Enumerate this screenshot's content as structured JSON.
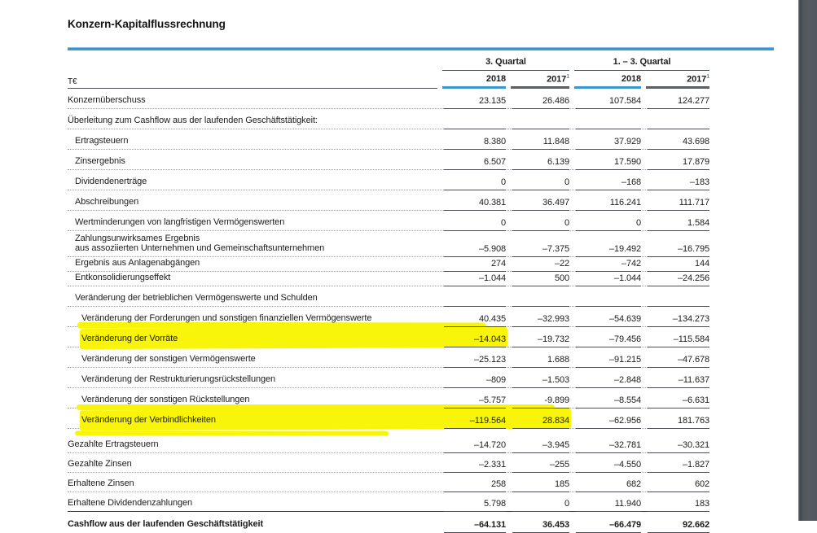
{
  "page": {
    "title": "Konzern-Kapitalflussrechnung",
    "accent_blue": "#3b97d3",
    "highlight_yellow": "#f8f50a",
    "viewer_band_gray": "#53585e"
  },
  "table": {
    "unit_label": "T€",
    "column_groups": [
      {
        "label": "3. Quartal"
      },
      {
        "label": "1. – 3. Quartal"
      }
    ],
    "year_headers": [
      {
        "label": "2018",
        "footnote": "",
        "accent": "blue"
      },
      {
        "label": "2017",
        "footnote": "1",
        "accent": "gray"
      },
      {
        "label": "2018",
        "footnote": "",
        "accent": "blue"
      },
      {
        "label": "2017",
        "footnote": "1",
        "accent": "gray"
      }
    ],
    "rows": [
      {
        "label": "Konzernüberschuss",
        "indent": 0,
        "values": [
          "23.135",
          "26.486",
          "107.584",
          "124.277"
        ]
      },
      {
        "label": "Überleitung zum Cashflow aus der laufenden Geschäftstätigkeit:",
        "indent": 0,
        "values": [
          "",
          "",
          "",
          ""
        ]
      },
      {
        "label": "Ertragsteuern",
        "indent": 1,
        "values": [
          "8.380",
          "11.848",
          "37.929",
          "43.698"
        ]
      },
      {
        "label": "Zinsergebnis",
        "indent": 1,
        "values": [
          "6.507",
          "6.139",
          "17.590",
          "17.879"
        ]
      },
      {
        "label": "Dividendenerträge",
        "indent": 1,
        "values": [
          "0",
          "0",
          "–168",
          "–183"
        ]
      },
      {
        "label": "Abschreibungen",
        "indent": 1,
        "values": [
          "40.381",
          "36.497",
          "116.241",
          "111.717"
        ]
      },
      {
        "label": "Wertminderungen von langfristigen Vermögenswerten",
        "indent": 1,
        "values": [
          "0",
          "0",
          "0",
          "1.584"
        ]
      },
      {
        "label": "Zahlungsunwirksames Ergebnis",
        "label2": "aus assoziierten Unternehmen und Gemeinschaftsunternehmen",
        "indent": 1,
        "values": [
          "–5.908",
          "–7.375",
          "–19.492",
          "–16.795"
        ]
      },
      {
        "label": "Ergebnis aus Anlagenabgängen",
        "indent": 1,
        "size": "c",
        "values": [
          "274",
          "–22",
          "–742",
          "144"
        ]
      },
      {
        "label": "Entkonsolidierungseffekt",
        "indent": 1,
        "size": "c",
        "values": [
          "–1.044",
          "500",
          "–1.044",
          "–24.256"
        ]
      },
      {
        "label": "Veränderung der betrieblichen Vermögenswerte und Schulden",
        "indent": 1,
        "values": [
          "",
          "",
          "",
          ""
        ]
      },
      {
        "label": "Veränderung der Forderungen und sonstigen finanziellen Vermögenswerte",
        "indent": 2,
        "values": [
          "40.435",
          "–32.993",
          "–54.639",
          "–134.273"
        ]
      },
      {
        "label": "Veränderung der Vorräte",
        "indent": 2,
        "highlight": 1,
        "values": [
          "–14.043",
          "–19.732",
          "–79.456",
          "–115.584"
        ]
      },
      {
        "label": "Veränderung der sonstigen Vermögenswerte",
        "indent": 2,
        "values": [
          "–25.123",
          "1.688",
          "–91.215",
          "–47.678"
        ]
      },
      {
        "label": "Veränderung der Restrukturierungsrückstellungen",
        "indent": 2,
        "values": [
          "–809",
          "–1.503",
          "–2.848",
          "–11.637"
        ]
      },
      {
        "label": "Veränderung der sonstigen Rückstellungen",
        "indent": 2,
        "values": [
          "–5.757",
          "-9.899",
          "–8.554",
          "–6.631"
        ]
      },
      {
        "label": "Veränderung der Verbindlichkeiten",
        "indent": 2,
        "highlight": 2,
        "values": [
          "–119.564",
          "28.834",
          "–62.956",
          "181.763"
        ]
      },
      {
        "gap": true
      },
      {
        "label": "Gezahlte Ertragsteuern",
        "indent": 0,
        "size": "s",
        "values": [
          "–14.720",
          "–3.945",
          "–32.781",
          "–30.321"
        ]
      },
      {
        "label": "Gezahlte Zinsen",
        "indent": 0,
        "size": "s",
        "values": [
          "–2.331",
          "–255",
          "–4.550",
          "–1.827"
        ]
      },
      {
        "label": "Erhaltene Zinsen",
        "indent": 0,
        "size": "s",
        "values": [
          "258",
          "185",
          "682",
          "602"
        ]
      },
      {
        "label": "Erhaltene Dividendenzahlungen",
        "indent": 0,
        "size": "s",
        "strong_rule": true,
        "values": [
          "5.798",
          "0",
          "11.940",
          "183"
        ]
      },
      {
        "label": "Cashflow aus der laufenden Geschäftstätigkeit",
        "indent": 0,
        "bold": true,
        "values": [
          "–64.131",
          "36.453",
          "–66.479",
          "92.662"
        ]
      }
    ]
  }
}
